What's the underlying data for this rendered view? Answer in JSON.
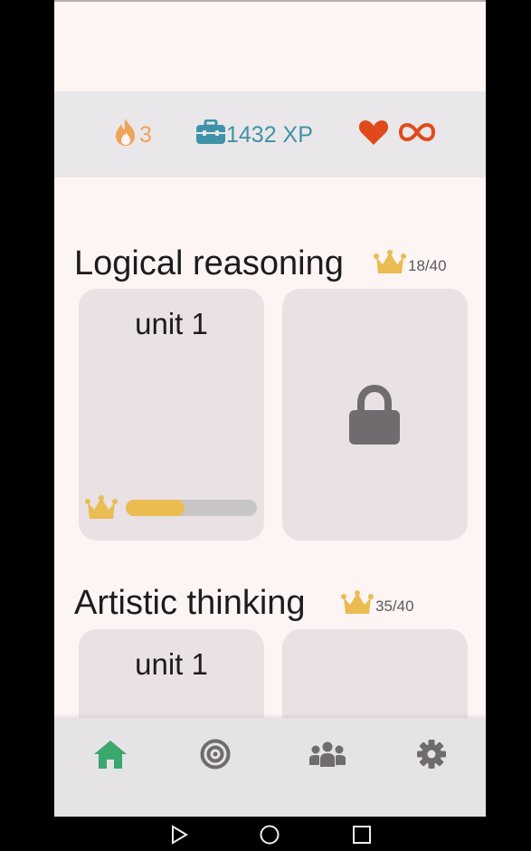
{
  "colors": {
    "background": "#fdf4f4",
    "stats_bar": "#e9e7e9",
    "streak": "#eea35a",
    "xp": "#3f93a8",
    "lives": "#e04a1a",
    "crown": "#ebbc52",
    "card": "#e9e1e3",
    "nav_active": "#3aa76d",
    "nav_inactive": "#6f6b6e",
    "lock": "#6f6b6e"
  },
  "stats": {
    "streak": {
      "icon": "flame-icon",
      "value": "3"
    },
    "xp": {
      "icon": "toolbox-icon",
      "value": "1432 XP"
    },
    "lives": {
      "icon": "heart-icon",
      "value_icon": "infinity-icon"
    }
  },
  "sections": [
    {
      "title": "Logical reasoning",
      "crowns": "18/40",
      "units": [
        {
          "title": "unit 1",
          "locked": false,
          "progress": 0.45
        },
        {
          "title": "",
          "locked": true
        }
      ]
    },
    {
      "title": "Artistic thinking",
      "crowns": "35/40",
      "units": [
        {
          "title": "unit 1",
          "locked": false
        },
        {
          "title": "",
          "locked": false
        }
      ]
    }
  ],
  "nav": [
    {
      "icon": "home-icon",
      "active": true
    },
    {
      "icon": "target-icon",
      "active": false
    },
    {
      "icon": "community-icon",
      "active": false
    },
    {
      "icon": "settings-gear-icon",
      "active": false
    }
  ],
  "system_nav": [
    "back-triangle-icon",
    "home-circle-icon",
    "recents-square-icon"
  ]
}
